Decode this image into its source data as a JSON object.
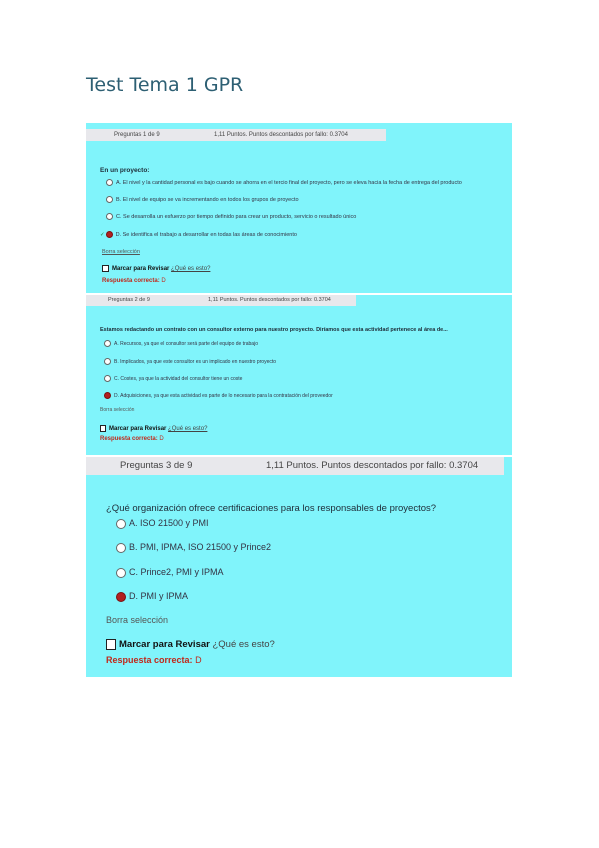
{
  "title": "Test Tema 1 GPR",
  "questions": [
    {
      "header_num": "Preguntas 1 de 9",
      "header_points": "1,11 Puntos. Puntos descontados por fallo: 0.3704",
      "question": "En un proyecto:",
      "options": [
        "A. El nivel y la cantidad personal es bajo cuando se ahorra en el tercio final del proyecto, pero se eleva hacia la fecha de entrega del producto",
        "B. El nivel de equipo se va incrementando en todos los grupos de proyecto",
        "C. Se desarrolla un esfuerzo por tiempo definido para crear un producto, servicio o resultado único",
        "D. Se identifica el trabajo a desarrollar en todas las áreas de conocimiento"
      ],
      "selected_index": 3,
      "clear": "Borra selección",
      "mark": "Marcar para Revisar",
      "what": "¿Qué es esto?",
      "answer_label": "Respuesta correcta:",
      "answer_value": "D"
    },
    {
      "header_num": "Preguntas 2 de 9",
      "header_points": "1,11 Puntos. Puntos descontados por fallo: 0.3704",
      "question": "Estamos redactando un contrato con un consultor externo para nuestro proyecto. Diríamos que esta actividad pertenece al área de...",
      "options": [
        "A. Recursos, ya que el consultor será parte del equipo de trabajo",
        "B. Implicados, ya que este consultor es un implicado en nuestro proyecto",
        "C. Costes, ya que la actividad del consultor tiene un coste",
        "D. Adquisiciones, ya que esta actividad es parte de lo necesario para la contratación del proveedor"
      ],
      "selected_index": 3,
      "clear": "Borra selección",
      "mark": "Marcar para Revisar",
      "what": "¿Qué es esto?",
      "answer_label": "Respuesta correcta:",
      "answer_value": "D"
    },
    {
      "header_num": "Preguntas 3 de 9",
      "header_points": "1,11 Puntos. Puntos descontados por fallo: 0.3704",
      "question": "¿Qué organización ofrece certificaciones para los responsables de proyectos?",
      "options": [
        "A. ISO 21500 y PMI",
        "B. PMI, IPMA, ISO 21500 y Prince2",
        "C. Prince2, PMI y IPMA",
        "D. PMI y IPMA"
      ],
      "selected_index": 3,
      "clear": "Borra selección",
      "mark": "Marcar para Revisar",
      "what": "¿Qué es esto?",
      "answer_label": "Respuesta correcta:",
      "answer_value": "D"
    }
  ]
}
